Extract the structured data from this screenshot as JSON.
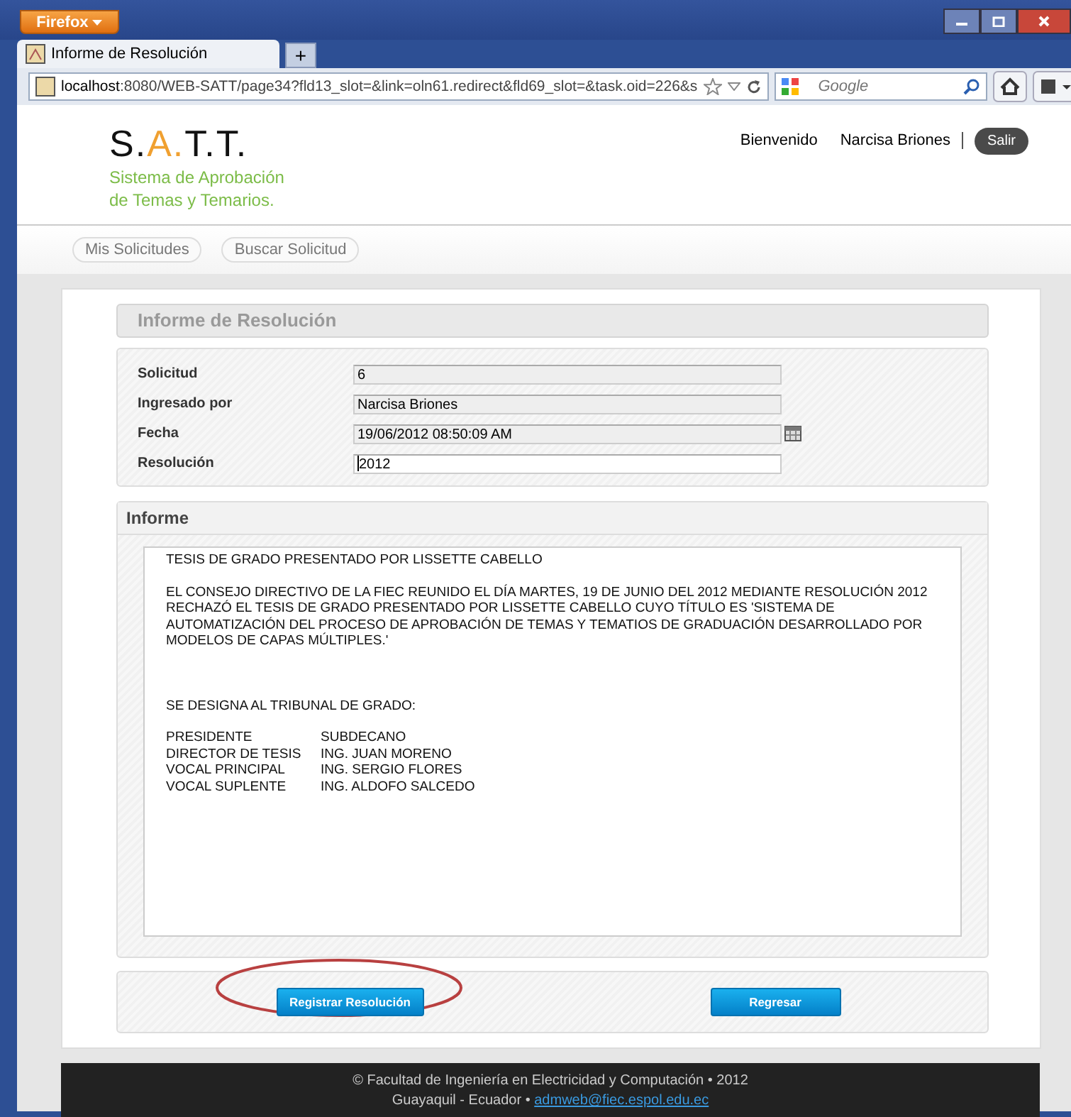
{
  "browser": {
    "menu_button": "Firefox",
    "tab_title": "Informe de Resolución",
    "new_tab": "+",
    "url_host": "localhost",
    "url_rest": ":8080/WEB-SATT/page34?fld13_slot=&link=oln61.redirect&fld69_slot=&task.oid=226&s",
    "search_placeholder": "Google"
  },
  "header": {
    "logo": [
      {
        "text": "S.",
        "accent": false
      },
      {
        "text": "A.",
        "accent": true
      },
      {
        "text": "T.T.",
        "accent": false
      }
    ],
    "subtitle_lines": [
      "Sistema de Aprobación",
      "de Temas y Temarios."
    ],
    "welcome": "Bienvenido",
    "user": "Narcisa Briones",
    "logout": "Salir"
  },
  "nav": [
    "Mis Solicitudes",
    "Buscar Solicitud"
  ],
  "form": {
    "title": "Informe de Resolución",
    "fields": [
      {
        "label": "Solicitud",
        "value": "6",
        "editable": false,
        "calendar": false
      },
      {
        "label": "Ingresado por",
        "value": "Narcisa Briones",
        "editable": false,
        "calendar": false
      },
      {
        "label": "Fecha",
        "value": "19/06/2012 08:50:09 AM",
        "editable": false,
        "calendar": true
      },
      {
        "label": "Resolución",
        "value": "2012",
        "editable": true,
        "calendar": false
      }
    ]
  },
  "informe": {
    "title": "Informe",
    "heading": "TESIS DE GRADO PRESENTADO POR LISSETTE CABELLO",
    "body": "EL CONSEJO DIRECTIVO DE LA FIEC REUNIDO EL DÍA MARTES, 19 DE JUNIO DEL 2012 MEDIANTE RESOLUCIÓN 2012 RECHAZÓ EL TESIS DE GRADO PRESENTADO POR LISSETTE CABELLO CUYO TÍTULO ES 'SISTEMA DE AUTOMATIZACIÓN DEL PROCESO DE APROBACIÓN DE TEMAS Y TEMATIOS DE GRADUACIÓN DESARROLLADO POR MODELOS DE CAPAS MÚLTIPLES.'",
    "designation": "SE DESIGNA AL TRIBUNAL DE GRADO:",
    "tribunal": [
      {
        "role": "PRESIDENTE",
        "name": "SUBDECANO"
      },
      {
        "role": "DIRECTOR DE TESIS",
        "name": "ING. JUAN MORENO"
      },
      {
        "role": "VOCAL PRINCIPAL",
        "name": "ING. SERGIO FLORES"
      },
      {
        "role": "VOCAL SUPLENTE",
        "name": "ING. ALDOFO SALCEDO"
      }
    ]
  },
  "actions": [
    {
      "label": "Registrar Resolución",
      "circled": true
    },
    {
      "label": "Regresar",
      "circled": false
    }
  ],
  "footer": {
    "line1": "© Facultad de Ingeniería en Electricidad y Computación • 2012",
    "line2": "Guayaquil - Ecuador •",
    "email": "admweb@fiec.espol.edu.ec"
  }
}
